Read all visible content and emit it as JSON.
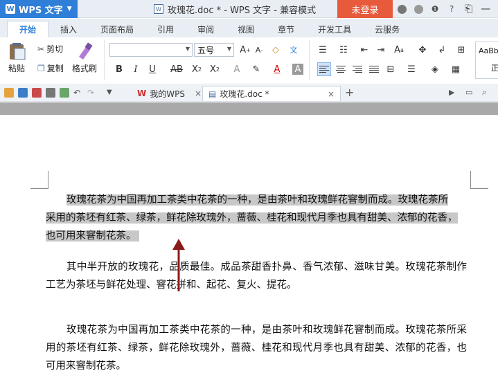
{
  "titlebar": {
    "app_name": "WPS 文字",
    "doc_title": "玫瑰花.doc * - WPS 文字 - 兼容模式",
    "login": "未登录"
  },
  "ribbon_tabs": [
    "开始",
    "插入",
    "页面布局",
    "引用",
    "审阅",
    "视图",
    "章节",
    "开发工具",
    "云服务"
  ],
  "ribbon": {
    "paste": "粘贴",
    "cut": "剪切",
    "copy": "复制",
    "format_painter": "格式刷",
    "font_size": "五号",
    "styles_preview": "AaBb",
    "styles_label": "正"
  },
  "doc_tabs": {
    "home": "我的WPS",
    "current": "玫瑰花.doc *"
  },
  "document": {
    "p1_hl1": "玫瑰花茶为中国再加工茶类中花茶的一种，是由茶叶和玫瑰鲜花窨制而成。玫瑰花茶所",
    "p1_hl2": "采用的茶坯有红茶、绿茶，鲜花除玫瑰外，蔷薇、桂花和现代月季也具有甜美、浓郁的花香，",
    "p1_hl3": "也可用来窨制花茶。",
    "p2": "其中半开放的玫瑰花，品质最佳。成品茶甜香扑鼻、香气浓郁、滋味甘美。玫瑰花茶制作工艺为茶坯与鲜花处理、窨花拼和、起花、复火、提花。",
    "p3": "玫瑰花茶为中国再加工茶类中花茶的一种，是由茶叶和玫瑰鲜花窨制而成。玫瑰花茶所采用的茶坯有红茶、绿茶，鲜花除玫瑰外，蔷薇、桂花和现代月季也具有甜美、浓郁的花香，也可用来窨制花茶。"
  },
  "colors": {
    "accent": "#2f7fd8",
    "login": "#e85a3c",
    "selection": "#c8c8c8",
    "arrow": "#8b1a1a"
  }
}
